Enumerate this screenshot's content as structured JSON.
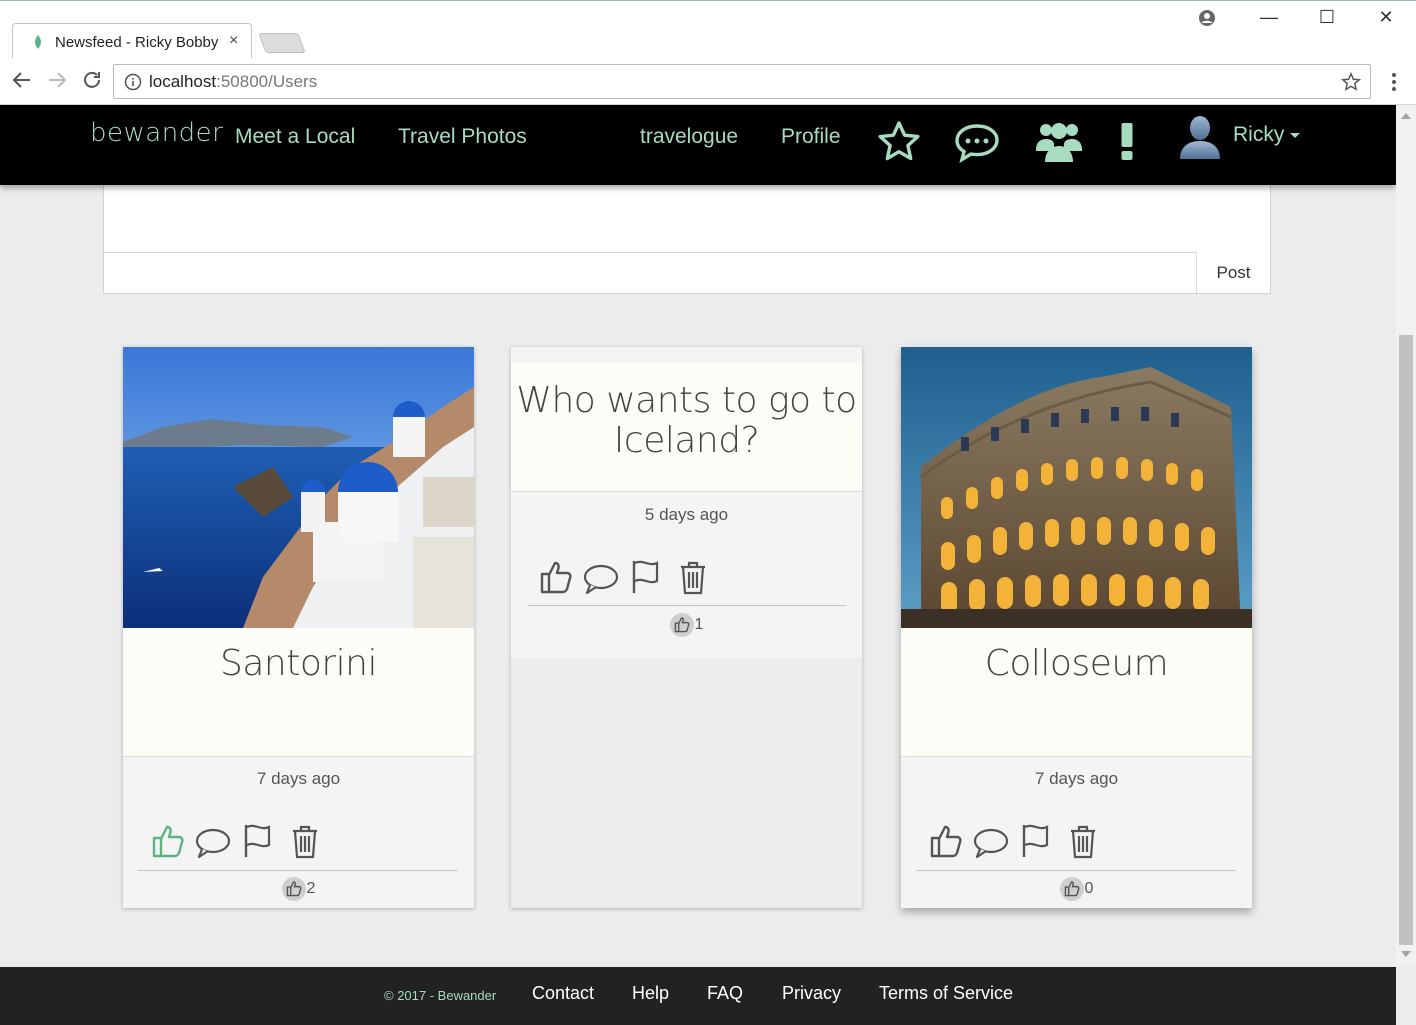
{
  "browser": {
    "tab_title": "Newsfeed - Ricky Bobby",
    "url_host": "localhost",
    "url_rest": ":50800/Users"
  },
  "navbar": {
    "brand": "bewander",
    "links": [
      "Meet a Local",
      "Travel Photos",
      "travelogue",
      "Profile"
    ],
    "user_name": "Ricky",
    "accent_color": "#a8dcc0"
  },
  "composer": {
    "post_label": "Post"
  },
  "cards": [
    {
      "title": "Santorini",
      "time": "7 days ago",
      "likes": "2",
      "liked": true
    },
    {
      "title": "Who wants to go to Iceland?",
      "time": "5 days ago",
      "likes": "1",
      "liked": false
    },
    {
      "title": "Colloseum",
      "time": "7 days ago",
      "likes": "0",
      "liked": false
    }
  ],
  "footer": {
    "copyright": "© 2017 - Bewander",
    "links": [
      "Contact",
      "Help",
      "FAQ",
      "Privacy",
      "Terms of Service"
    ]
  },
  "icons": {
    "nav": [
      "star-icon",
      "chat-icon",
      "group-icon",
      "alert-icon",
      "avatar"
    ],
    "card_actions": [
      "thumbs-up-icon",
      "comment-icon",
      "flag-icon",
      "trash-icon"
    ]
  }
}
